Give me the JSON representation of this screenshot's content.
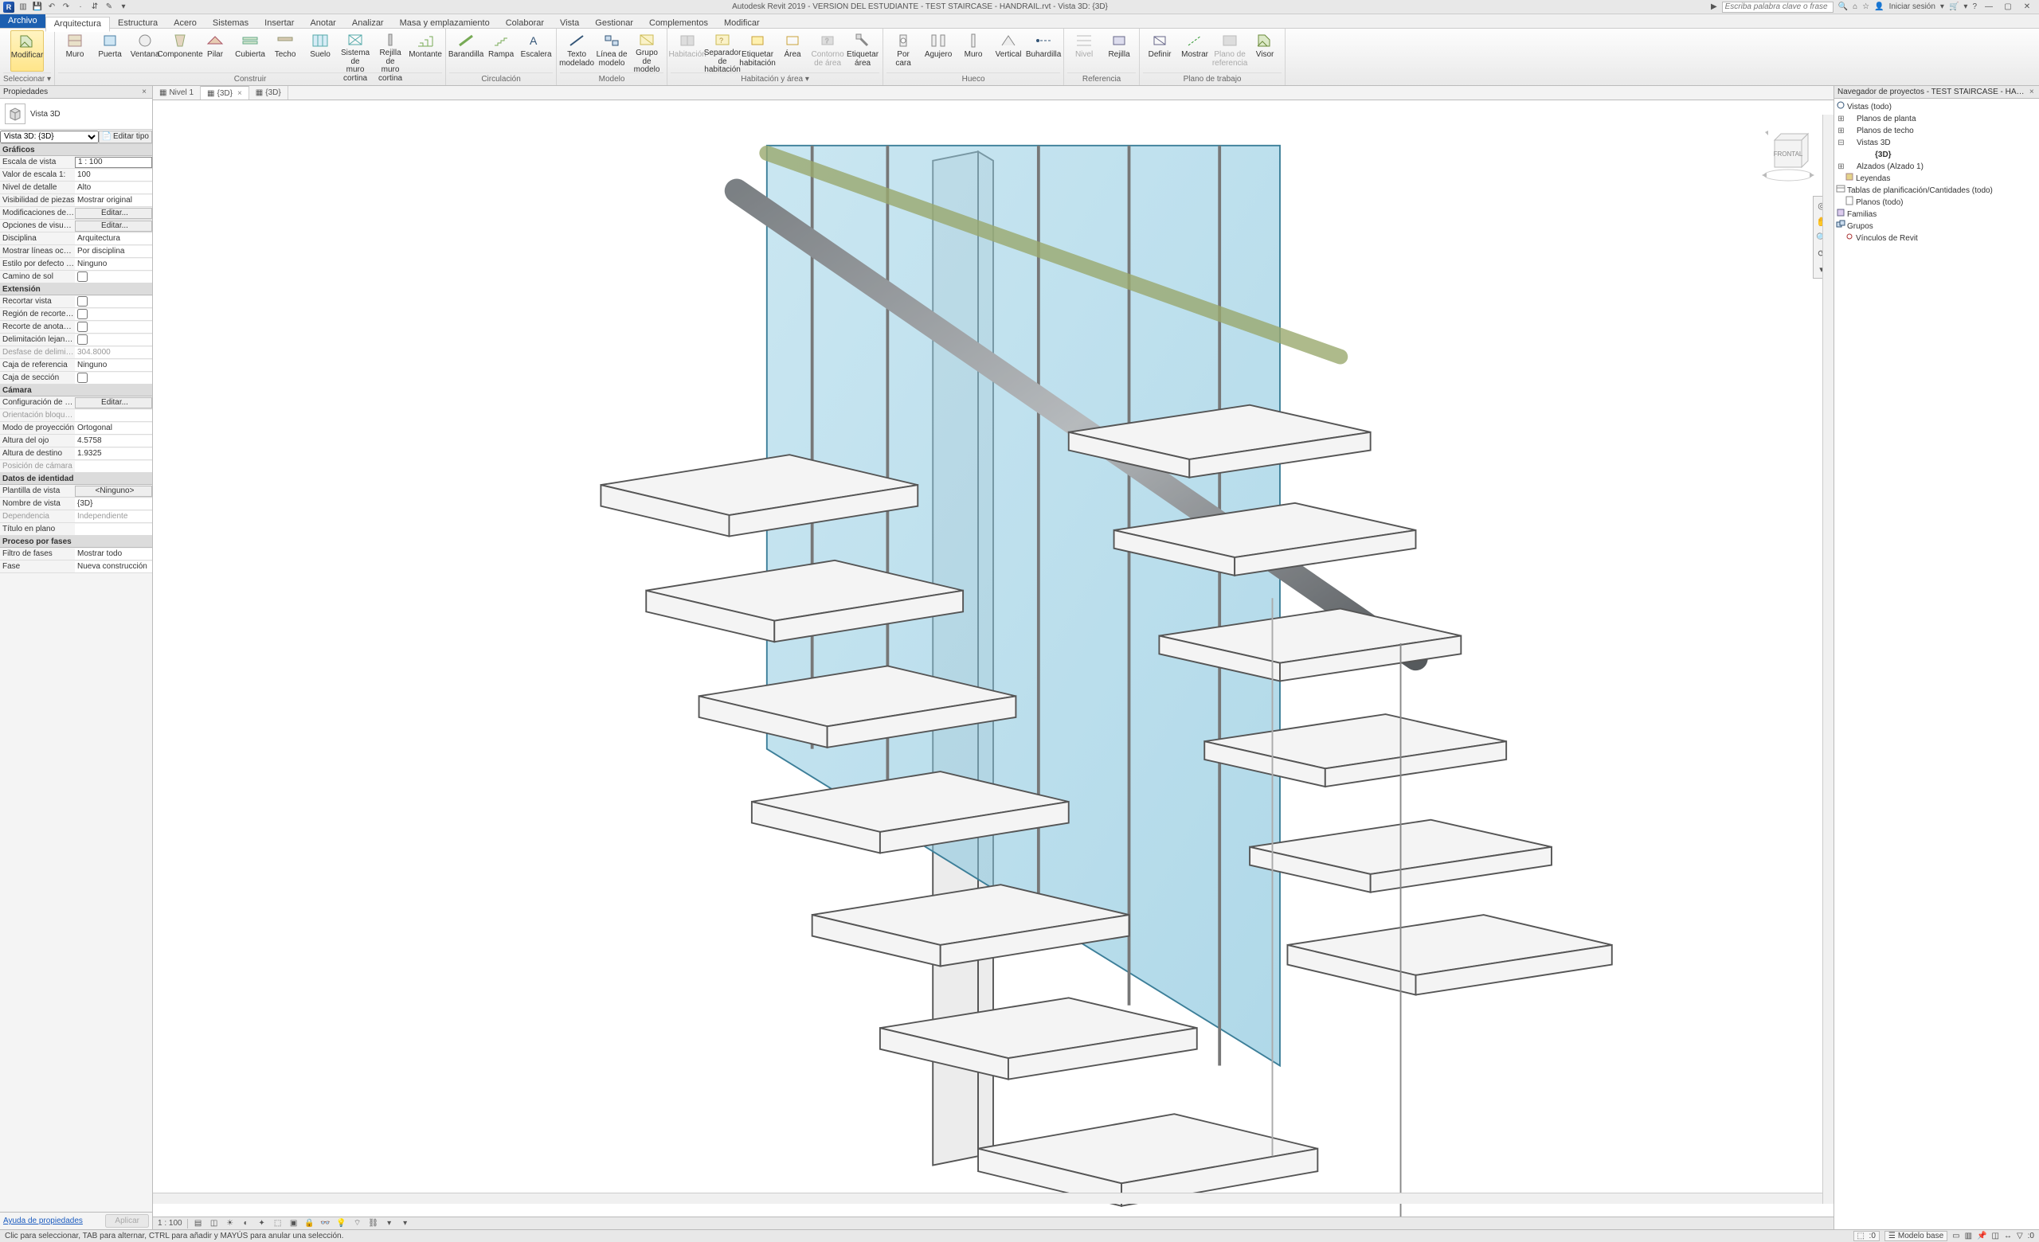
{
  "title": "Autodesk Revit 2019 - VERSIÓN DEL ESTUDIANTE -   TEST STAIRCASE - HANDRAIL.rvt - Vista 3D: {3D}",
  "search_placeholder": "Escriba palabra clave o frase",
  "signin": "Iniciar sesión",
  "tabs": {
    "file": "Archivo",
    "items": [
      "Arquitectura",
      "Estructura",
      "Acero",
      "Sistemas",
      "Insertar",
      "Anotar",
      "Analizar",
      "Masa y emplazamiento",
      "Colaborar",
      "Vista",
      "Gestionar",
      "Complementos",
      "Modificar"
    ],
    "active": "Arquitectura"
  },
  "ribbon": {
    "groups": [
      {
        "label": "Seleccionar ▾",
        "buttons": [
          {
            "t": "Modificar",
            "sel": true
          }
        ]
      },
      {
        "label": "Construir",
        "buttons": [
          {
            "t": "Muro"
          },
          {
            "t": "Puerta"
          },
          {
            "t": "Ventana"
          },
          {
            "t": "Componente"
          },
          {
            "t": "Pilar"
          },
          {
            "t": "Cubierta"
          },
          {
            "t": "Techo"
          },
          {
            "t": "Suelo"
          },
          {
            "t": "Sistema de\nmuro cortina"
          },
          {
            "t": "Rejilla de\nmuro cortina"
          },
          {
            "t": "Montante"
          }
        ]
      },
      {
        "label": "Circulación",
        "buttons": [
          {
            "t": "Barandilla"
          },
          {
            "t": "Rampa"
          },
          {
            "t": "Escalera"
          }
        ]
      },
      {
        "label": "Modelo",
        "buttons": [
          {
            "t": "Texto\nmodelado"
          },
          {
            "t": "Línea de\nmodelo"
          },
          {
            "t": "Grupo de\nmodelo"
          }
        ]
      },
      {
        "label": "Habitación y área ▾",
        "buttons": [
          {
            "t": "Habitación",
            "dis": true
          },
          {
            "t": "Separador\nde habitación"
          },
          {
            "t": "Etiquetar\nhabitación"
          },
          {
            "t": "Área"
          },
          {
            "t": "Contorno\nde área",
            "dis": true
          },
          {
            "t": "Etiquetar\nárea"
          }
        ]
      },
      {
        "label": "Hueco",
        "buttons": [
          {
            "t": "Por\ncara"
          },
          {
            "t": "Agujero"
          },
          {
            "t": "Muro"
          },
          {
            "t": "Vertical"
          },
          {
            "t": "Buhardilla"
          }
        ]
      },
      {
        "label": "Referencia",
        "buttons": [
          {
            "t": "Nivel",
            "dis": true
          },
          {
            "t": "Rejilla"
          }
        ]
      },
      {
        "label": "Plano de trabajo",
        "buttons": [
          {
            "t": "Definir"
          },
          {
            "t": "Mostrar"
          },
          {
            "t": "Plano de\nreferencia",
            "dis": true
          },
          {
            "t": "Visor"
          }
        ]
      }
    ]
  },
  "view_tabs": [
    {
      "label": "Nivel 1",
      "active": false
    },
    {
      "label": "{3D}",
      "active": true,
      "closable": true
    },
    {
      "label": "{3D}",
      "active": false
    }
  ],
  "viewcube_face": "FRONTAL",
  "props_panel": {
    "title": "Propiedades",
    "type_name": "Vista 3D",
    "selector": "Vista 3D: {3D}",
    "edit_type": "Editar tipo",
    "sections": [
      {
        "h": "Gráficos",
        "rows": [
          {
            "k": "Escala de vista",
            "v": "1 : 100",
            "boxed": true
          },
          {
            "k": "Valor de escala   1:",
            "v": "100"
          },
          {
            "k": "Nivel de detalle",
            "v": "Alto"
          },
          {
            "k": "Visibilidad de piezas",
            "v": "Mostrar original"
          },
          {
            "k": "Modificaciones de visibilidad…",
            "v": "Editar...",
            "btn": true
          },
          {
            "k": "Opciones de visualización de…",
            "v": "Editar...",
            "btn": true
          },
          {
            "k": "Disciplina",
            "v": "Arquitectura"
          },
          {
            "k": "Mostrar líneas ocultas",
            "v": "Por disciplina"
          },
          {
            "k": "Estilo por defecto de visuali…",
            "v": "Ninguno"
          },
          {
            "k": "Camino de sol",
            "v": "",
            "chk": false
          }
        ]
      },
      {
        "h": "Extensión",
        "rows": [
          {
            "k": "Recortar vista",
            "v": "",
            "chk": false
          },
          {
            "k": "Región de recorte visible",
            "v": "",
            "chk": false
          },
          {
            "k": "Recorte de anotación",
            "v": "",
            "chk": false
          },
          {
            "k": "Delimitación lejana activa",
            "v": "",
            "chk": false
          },
          {
            "k": "Desfase de delimitación lejano",
            "v": "304.8000",
            "dim": true
          },
          {
            "k": "Caja de referencia",
            "v": "Ninguno"
          },
          {
            "k": "Caja de sección",
            "v": "",
            "chk": false
          }
        ]
      },
      {
        "h": "Cámara",
        "rows": [
          {
            "k": "Configuración de renderizaci…",
            "v": "Editar...",
            "btn": true
          },
          {
            "k": "Orientación bloqueada",
            "v": "",
            "dim": true
          },
          {
            "k": "Modo de proyección",
            "v": "Ortogonal"
          },
          {
            "k": "Altura del ojo",
            "v": "4.5758"
          },
          {
            "k": "Altura de destino",
            "v": "1.9325"
          },
          {
            "k": "Posición de cámara",
            "v": "",
            "dim": true
          }
        ]
      },
      {
        "h": "Datos de identidad",
        "rows": [
          {
            "k": "Plantilla de vista",
            "v": "<Ninguno>",
            "btn": true
          },
          {
            "k": "Nombre de vista",
            "v": "{3D}"
          },
          {
            "k": "Dependencia",
            "v": "Independiente",
            "dim": true
          },
          {
            "k": "Título en plano",
            "v": ""
          }
        ]
      },
      {
        "h": "Proceso por fases",
        "rows": [
          {
            "k": "Filtro de fases",
            "v": "Mostrar todo"
          },
          {
            "k": "Fase",
            "v": "Nueva construcción"
          }
        ]
      }
    ],
    "help": "Ayuda de propiedades",
    "apply": "Aplicar"
  },
  "view_bottom": {
    "scale": "1 : 100"
  },
  "browser": {
    "title": "Navegador de proyectos - TEST STAIRCASE - HANDRAIL.rvt",
    "tree": [
      {
        "d": 0,
        "tw": "−",
        "t": "Vistas (todo)",
        "ic": "o"
      },
      {
        "d": 1,
        "tw": "+",
        "t": "Planos de planta"
      },
      {
        "d": 1,
        "tw": "+",
        "t": "Planos de techo"
      },
      {
        "d": 1,
        "tw": "−",
        "t": "Vistas 3D"
      },
      {
        "d": 2,
        "tw": "",
        "t": "{3D}",
        "bold": true
      },
      {
        "d": 1,
        "tw": "+",
        "t": "Alzados (Alzado 1)"
      },
      {
        "d": 0,
        "tw": "",
        "t": "Leyendas",
        "ic": "leg"
      },
      {
        "d": 0,
        "tw": "+",
        "t": "Tablas de planificación/Cantidades (todo)",
        "ic": "tab"
      },
      {
        "d": 0,
        "tw": "",
        "t": "Planos (todo)",
        "ic": "sheet"
      },
      {
        "d": 0,
        "tw": "+",
        "t": "Familias",
        "ic": "fam"
      },
      {
        "d": 0,
        "tw": "+",
        "t": "Grupos",
        "ic": "grp"
      },
      {
        "d": 0,
        "tw": "",
        "t": "Vínculos de Revit",
        "ic": "link"
      }
    ]
  },
  "status": {
    "hint": "Clic para seleccionar, TAB para alternar, CTRL para añadir y MAYÚS para anular una selección.",
    "model": "Modelo base"
  }
}
